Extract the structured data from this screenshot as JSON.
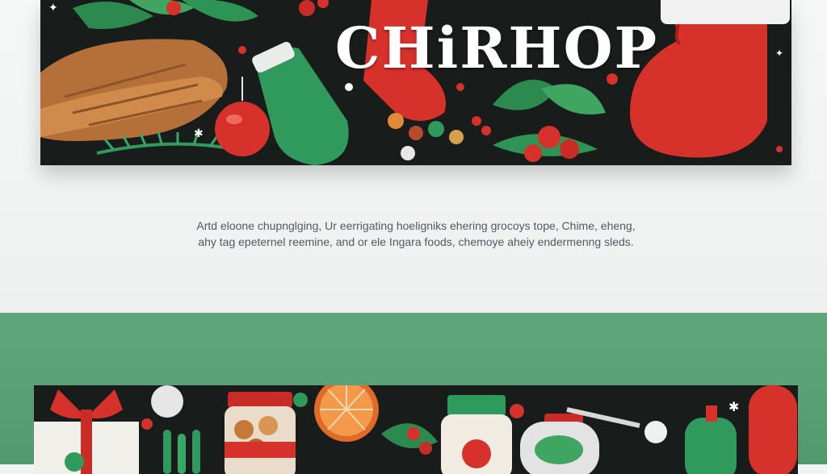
{
  "hero": {
    "brand": "CHiRHOP",
    "tagline_line1": "Artd eloone chupnglging, Ur eerrigating hoeligniks ehering grocoys tope, Chime, eheng,",
    "tagline_line2": "ahy tag epeternel reemine, and or ele Ingara foods, chemoye aheiy endermenng sleds."
  },
  "colors": {
    "banner_bg": "#181c1b",
    "green_section": "#58a074",
    "accent_red": "#d7312b",
    "accent_green": "#2f9a5c"
  }
}
